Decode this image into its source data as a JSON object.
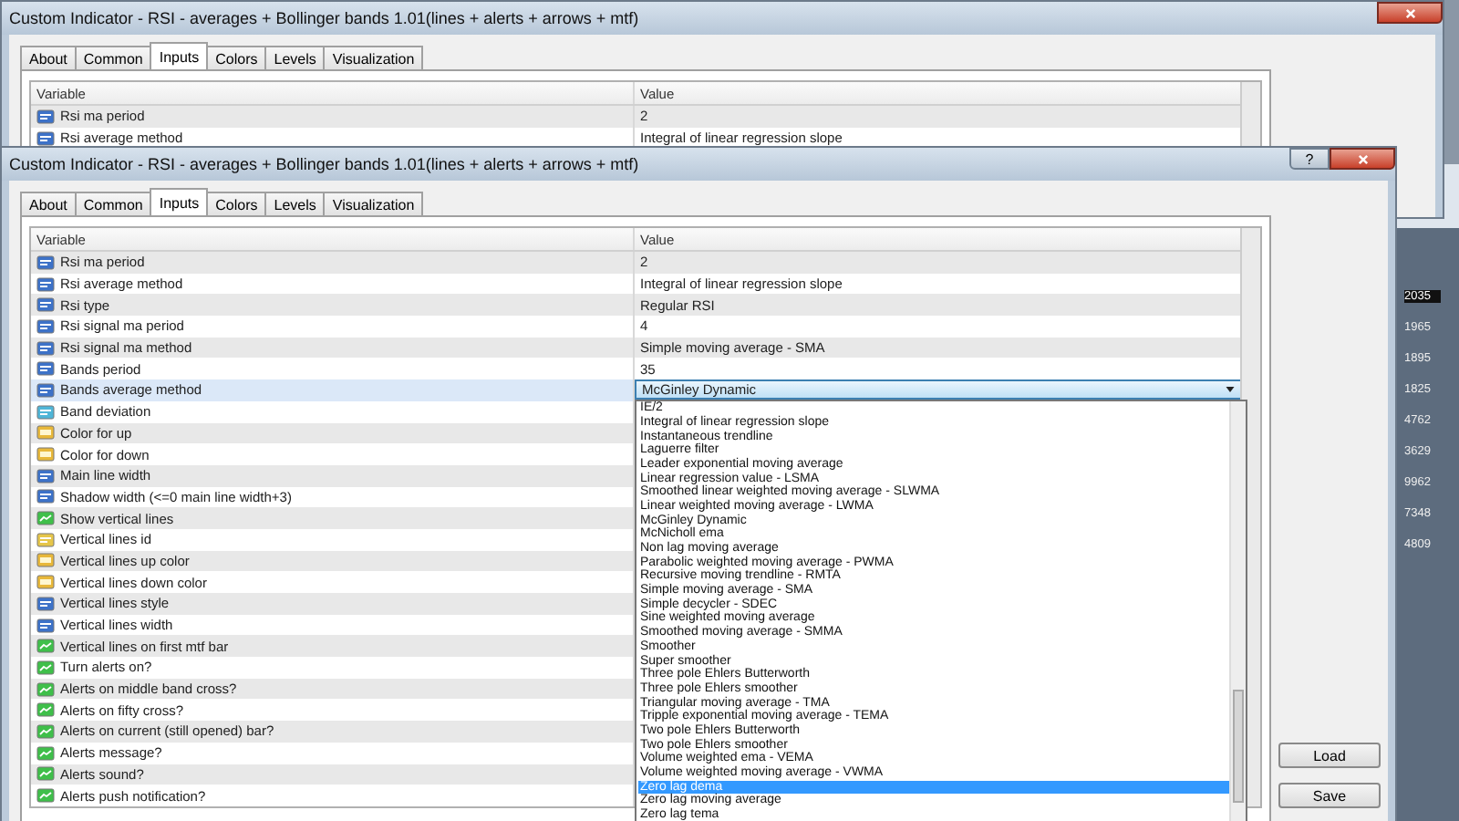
{
  "back_window": {
    "title": "Custom Indicator - RSI - averages + Bollinger bands 1.01(lines + alerts + arrows + mtf)",
    "tabs": [
      {
        "label": "About",
        "selected": false
      },
      {
        "label": "Common",
        "selected": false
      },
      {
        "label": "Inputs",
        "selected": true
      },
      {
        "label": "Colors",
        "selected": false
      },
      {
        "label": "Levels",
        "selected": false
      },
      {
        "label": "Visualization",
        "selected": false
      }
    ],
    "columns": [
      "Variable",
      "Value"
    ],
    "rows": [
      {
        "kind": "int",
        "name": "Rsi ma period",
        "value": "2"
      },
      {
        "kind": "int",
        "name": "Rsi average method",
        "value": "Integral of linear regression slope"
      }
    ]
  },
  "front_window": {
    "title": "Custom Indicator - RSI - averages + Bollinger bands 1.01(lines + alerts + arrows + mtf)",
    "help": "?",
    "tabs": [
      {
        "label": "About",
        "selected": false
      },
      {
        "label": "Common",
        "selected": false
      },
      {
        "label": "Inputs",
        "selected": true
      },
      {
        "label": "Colors",
        "selected": false
      },
      {
        "label": "Levels",
        "selected": false
      },
      {
        "label": "Visualization",
        "selected": false
      }
    ],
    "columns": [
      "Variable",
      "Value"
    ],
    "rows": [
      {
        "kind": "int",
        "name": "Rsi ma period",
        "value": "2",
        "selected": false
      },
      {
        "kind": "int",
        "name": "Rsi average method",
        "value": "Integral of linear regression slope",
        "selected": false
      },
      {
        "kind": "int",
        "name": "Rsi type",
        "value": "Regular RSI",
        "selected": false
      },
      {
        "kind": "int",
        "name": "Rsi signal ma period",
        "value": "4",
        "selected": false
      },
      {
        "kind": "int",
        "name": "Rsi signal ma method",
        "value": "Simple moving average - SMA",
        "selected": false
      },
      {
        "kind": "int",
        "name": "Bands period",
        "value": "35",
        "selected": false
      },
      {
        "kind": "int",
        "name": "Bands average method",
        "value": "McGinley Dynamic",
        "selected": true
      },
      {
        "kind": "double",
        "name": "Band deviation",
        "selected": false
      },
      {
        "kind": "color",
        "name": "Color for up",
        "selected": false
      },
      {
        "kind": "color",
        "name": "Color for down",
        "selected": false
      },
      {
        "kind": "int",
        "name": "Main line width",
        "selected": false
      },
      {
        "kind": "int",
        "name": "Shadow width (<=0 main line width+3)",
        "selected": false
      },
      {
        "kind": "bool",
        "name": "Show vertical lines",
        "selected": false
      },
      {
        "kind": "string",
        "name": "Vertical lines id",
        "selected": false
      },
      {
        "kind": "color",
        "name": "Vertical lines up color",
        "selected": false
      },
      {
        "kind": "color",
        "name": "Vertical lines down color",
        "selected": false
      },
      {
        "kind": "int",
        "name": "Vertical lines style",
        "selected": false
      },
      {
        "kind": "int",
        "name": "Vertical lines width",
        "selected": false
      },
      {
        "kind": "bool",
        "name": "Vertical lines on first mtf bar",
        "selected": false
      },
      {
        "kind": "bool",
        "name": "Turn alerts on?",
        "selected": false
      },
      {
        "kind": "bool",
        "name": "Alerts on middle band cross?",
        "selected": false
      },
      {
        "kind": "bool",
        "name": "Alerts on fifty cross?",
        "selected": false
      },
      {
        "kind": "bool",
        "name": "Alerts on current (still opened) bar?",
        "selected": false
      },
      {
        "kind": "bool",
        "name": "Alerts message?",
        "selected": false
      },
      {
        "kind": "bool",
        "name": "Alerts sound?",
        "selected": false
      },
      {
        "kind": "bool",
        "name": "Alerts push notification?",
        "selected": false
      }
    ],
    "dropdown_options": [
      {
        "label": "IE/2",
        "selected": false
      },
      {
        "label": "Integral of linear regression slope",
        "selected": false
      },
      {
        "label": "Instantaneous trendline",
        "selected": false
      },
      {
        "label": "Laguerre filter",
        "selected": false
      },
      {
        "label": "Leader exponential moving average",
        "selected": false
      },
      {
        "label": "Linear regression value - LSMA",
        "selected": false
      },
      {
        "label": "Smoothed linear weighted moving average - SLWMA",
        "selected": false
      },
      {
        "label": "Linear weighted moving average - LWMA",
        "selected": false
      },
      {
        "label": "McGinley Dynamic",
        "selected": false
      },
      {
        "label": "McNicholl ema",
        "selected": false
      },
      {
        "label": "Non lag moving average",
        "selected": false
      },
      {
        "label": "Parabolic weighted moving average - PWMA",
        "selected": false
      },
      {
        "label": "Recursive moving trendline - RMTA",
        "selected": false
      },
      {
        "label": "Simple moving average - SMA",
        "selected": false
      },
      {
        "label": "Simple decycler - SDEC",
        "selected": false
      },
      {
        "label": "Sine weighted moving average",
        "selected": false
      },
      {
        "label": "Smoothed moving average - SMMA",
        "selected": false
      },
      {
        "label": "Smoother",
        "selected": false
      },
      {
        "label": "Super smoother",
        "selected": false
      },
      {
        "label": "Three pole Ehlers Butterworth",
        "selected": false
      },
      {
        "label": "Three pole Ehlers smoother",
        "selected": false
      },
      {
        "label": "Triangular moving average - TMA",
        "selected": false
      },
      {
        "label": "Tripple exponential moving average - TEMA",
        "selected": false
      },
      {
        "label": "Two pole Ehlers Butterworth",
        "selected": false
      },
      {
        "label": "Two pole Ehlers smoother",
        "selected": false
      },
      {
        "label": "Volume weighted ema - VEMA",
        "selected": false
      },
      {
        "label": "Volume weighted moving average - VWMA",
        "selected": false
      },
      {
        "label": "Zero lag dema",
        "selected": true
      },
      {
        "label": "Zero lag moving average",
        "selected": false
      },
      {
        "label": "Zero lag tema",
        "selected": false
      }
    ],
    "buttons": [
      "Load",
      "Save"
    ]
  },
  "chart_price_labels": [
    {
      "text": "2035",
      "selected": true
    },
    {
      "text": "1965",
      "selected": false
    },
    {
      "text": "1895",
      "selected": false
    },
    {
      "text": "1825",
      "selected": false
    },
    {
      "text": "4762",
      "selected": false
    },
    {
      "text": "3629",
      "selected": false
    },
    {
      "text": "9962",
      "selected": false
    },
    {
      "text": "7348",
      "selected": false
    },
    {
      "text": "4809",
      "selected": false
    }
  ]
}
